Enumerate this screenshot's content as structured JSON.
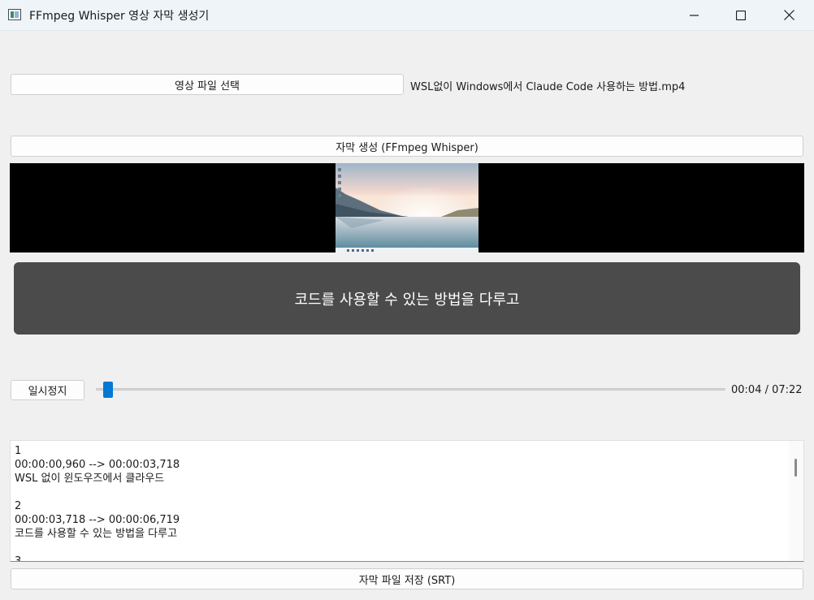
{
  "window": {
    "title": "FFmpeg Whisper 영상 자막 생성기",
    "controls": [
      "minimize-icon",
      "maximize-icon",
      "close-icon"
    ]
  },
  "file": {
    "select_button": "영상 파일 선택",
    "selected_name": "WSL없이 Windows에서 Claude Code 사용하는 방법.mp4"
  },
  "generate_button": "자막 생성 (FFmpeg Whisper)",
  "caption": "코드를 사용할 수 있는 방법을 다루고",
  "player": {
    "pause_button": "일시정지",
    "time": "00:04 / 07:22",
    "progress": 0.009
  },
  "srt": {
    "lines": [
      "1",
      "00:00:00,960 --> 00:00:03,718",
      "WSL 없이 윈도우즈에서 클라우드",
      "",
      "2",
      "00:00:03,718 --> 00:00:06,719",
      "코드를 사용할 수 있는 방법을 다루고",
      "",
      "3"
    ]
  },
  "save_button": "자막 파일 저장 (SRT)",
  "colors": {
    "accent": "#0078d4",
    "caption_bg": "#4b4b4b",
    "window_bg": "#f0f0f0"
  }
}
